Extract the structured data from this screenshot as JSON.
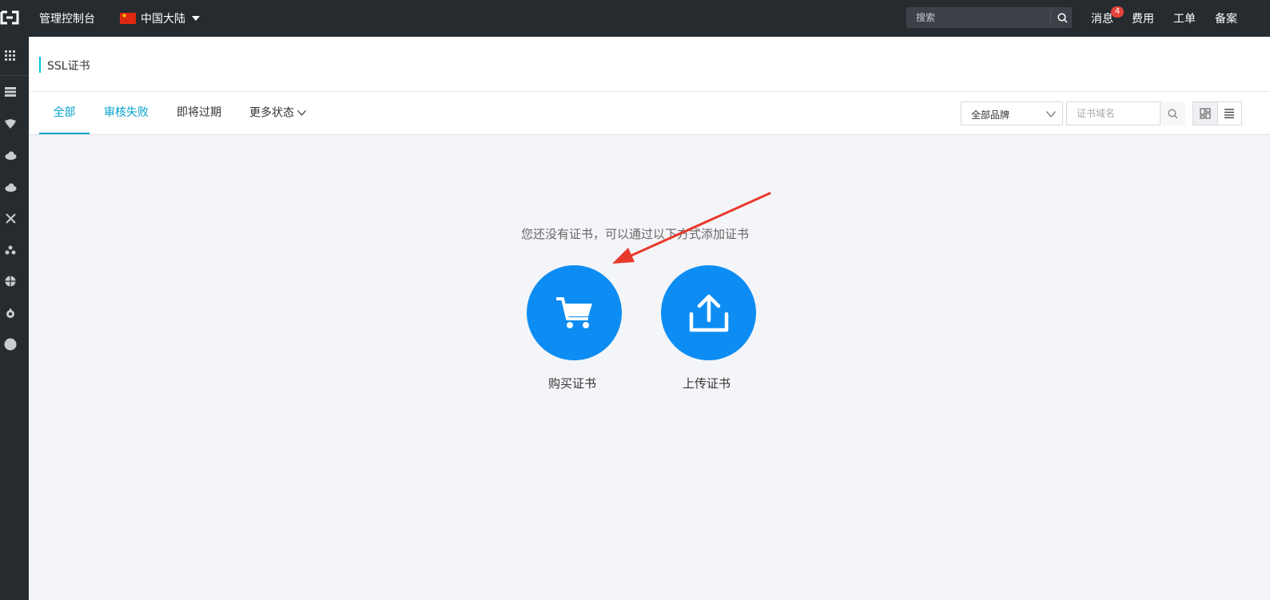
{
  "topbar": {
    "console_title": "管理控制台",
    "region": "中国大陆",
    "search_placeholder": "搜索",
    "links": {
      "messages": "消息",
      "billing": "费用",
      "tickets": "工单",
      "icp": "备案"
    },
    "message_badge": "4"
  },
  "sidebar": {
    "icons": [
      "grid-icon",
      "server-icon",
      "database-icon",
      "cloud-icon",
      "cloud-upload-icon",
      "network-icon",
      "cluster-icon",
      "globe-icon",
      "settings-icon",
      "circle-icon"
    ]
  },
  "header": {
    "title": "SSL证书"
  },
  "tabs": {
    "all": "全部",
    "failed": "审核失败",
    "expiring": "即将过期",
    "more": "更多状态"
  },
  "filters": {
    "brand_selected": "全部品牌",
    "domain_placeholder": "证书域名"
  },
  "empty_state": {
    "message": "您还没有证书，可以通过以下方式添加证书",
    "buy_label": "购买证书",
    "upload_label": "上传证书"
  },
  "colors": {
    "accent": "#00a2ca",
    "primary_circle": "#0d8df3",
    "topbar": "#262b30",
    "annotation_arrow": "#e8392c"
  }
}
